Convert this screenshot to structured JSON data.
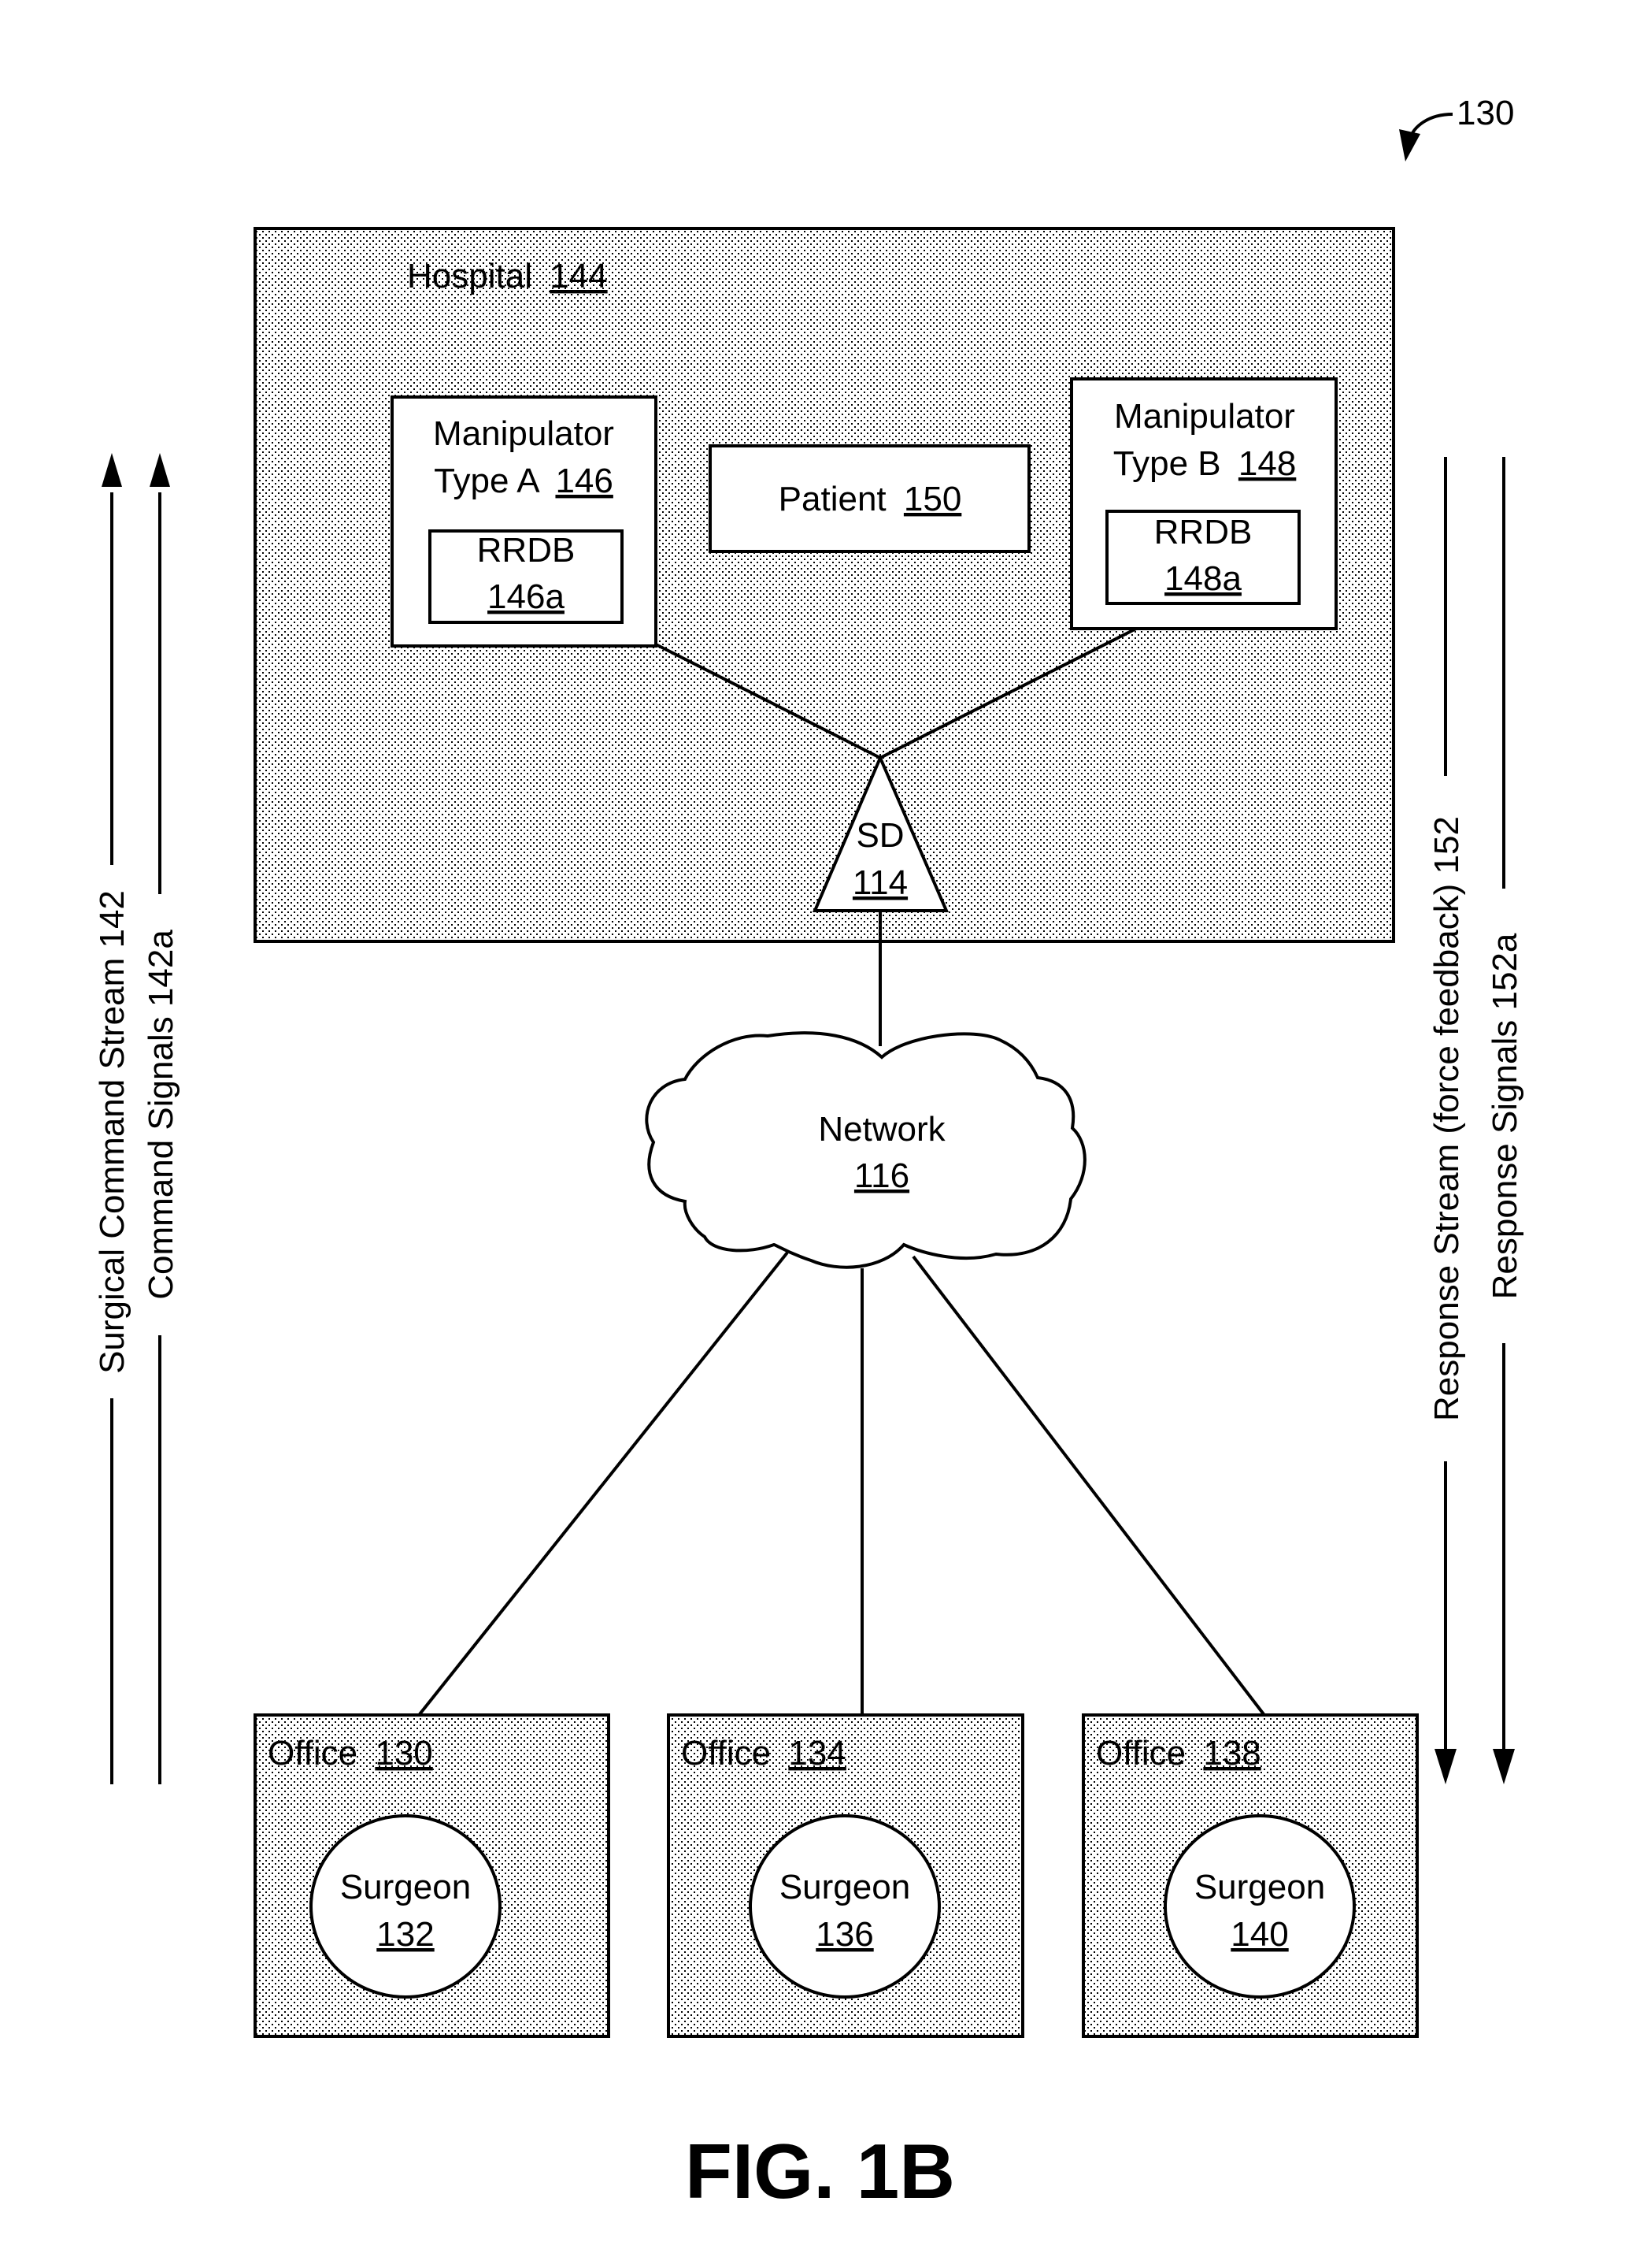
{
  "figure": {
    "ref_label": "130",
    "caption": "FIG. 1B",
    "pattern_fill_color": "#000000",
    "background_color": "#ffffff"
  },
  "hospital": {
    "name": "Hospital",
    "ref": "144",
    "manipulator_a": {
      "line1": "Manipulator",
      "line2": "Type A",
      "ref": "146",
      "db_name": "RRDB",
      "db_ref": "146a"
    },
    "patient": {
      "name": "Patient",
      "ref": "150"
    },
    "manipulator_b": {
      "line1": "Manipulator",
      "line2": "Type B",
      "ref": "148",
      "db_name": "RRDB",
      "db_ref": "148a"
    },
    "sd": {
      "name": "SD",
      "ref": "114"
    }
  },
  "network": {
    "name": "Network",
    "ref": "116"
  },
  "offices": [
    {
      "name": "Office",
      "ref": "130",
      "surgeon": "Surgeon",
      "surgeon_ref": "132"
    },
    {
      "name": "Office",
      "ref": "134",
      "surgeon": "Surgeon",
      "surgeon_ref": "136"
    },
    {
      "name": "Office",
      "ref": "138",
      "surgeon": "Surgeon",
      "surgeon_ref": "140"
    }
  ],
  "streams": {
    "left": [
      {
        "label": "Surgical Command Stream 142",
        "direction": "up"
      },
      {
        "label": "Command Signals 142a",
        "direction": "up"
      }
    ],
    "right": [
      {
        "label": "Response Stream (force feedback) 152",
        "direction": "down"
      },
      {
        "label": "Response Signals 152a",
        "direction": "down"
      }
    ]
  }
}
